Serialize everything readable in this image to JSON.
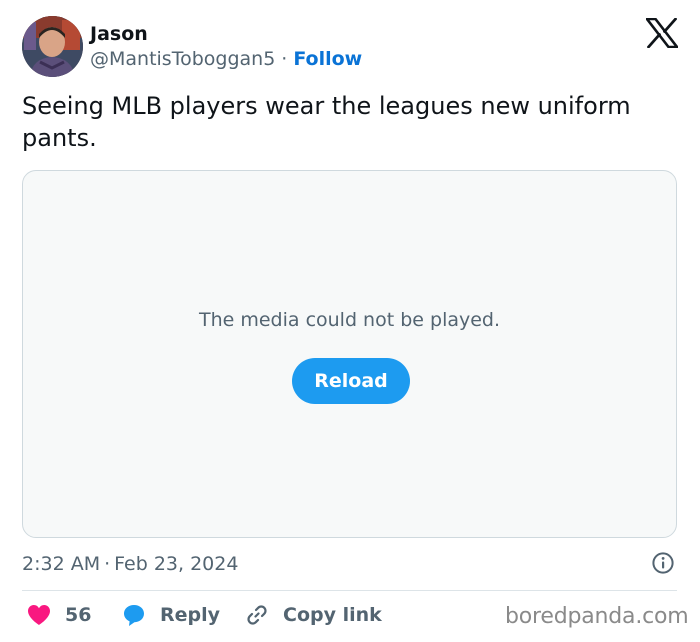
{
  "author": {
    "name": "Jason",
    "handle": "@MantisToboggan5",
    "separator": "·",
    "follow_label": "Follow",
    "avatar_icon": "profile-photo"
  },
  "brand_icon": "x-logo",
  "tweet": {
    "text": "Seeing MLB players wear the leagues new uniform pants."
  },
  "media": {
    "error_message": "The media could not be played.",
    "reload_label": "Reload"
  },
  "meta": {
    "time": "2:32 AM",
    "separator": "·",
    "date": "Feb 23, 2024",
    "info_icon": "info-icon"
  },
  "actions": {
    "like": {
      "count": "56",
      "icon": "heart-icon"
    },
    "reply": {
      "label": "Reply",
      "icon": "speech-bubble-icon"
    },
    "copy_link": {
      "label": "Copy link",
      "icon": "link-icon"
    }
  },
  "watermark": "boredpanda.com",
  "colors": {
    "accent": "#1d9bf0",
    "follow": "#0a73d6",
    "like": "#f91880",
    "secondary_text": "#536471",
    "primary_text": "#0f1419",
    "media_bg": "#f7f9f9"
  }
}
